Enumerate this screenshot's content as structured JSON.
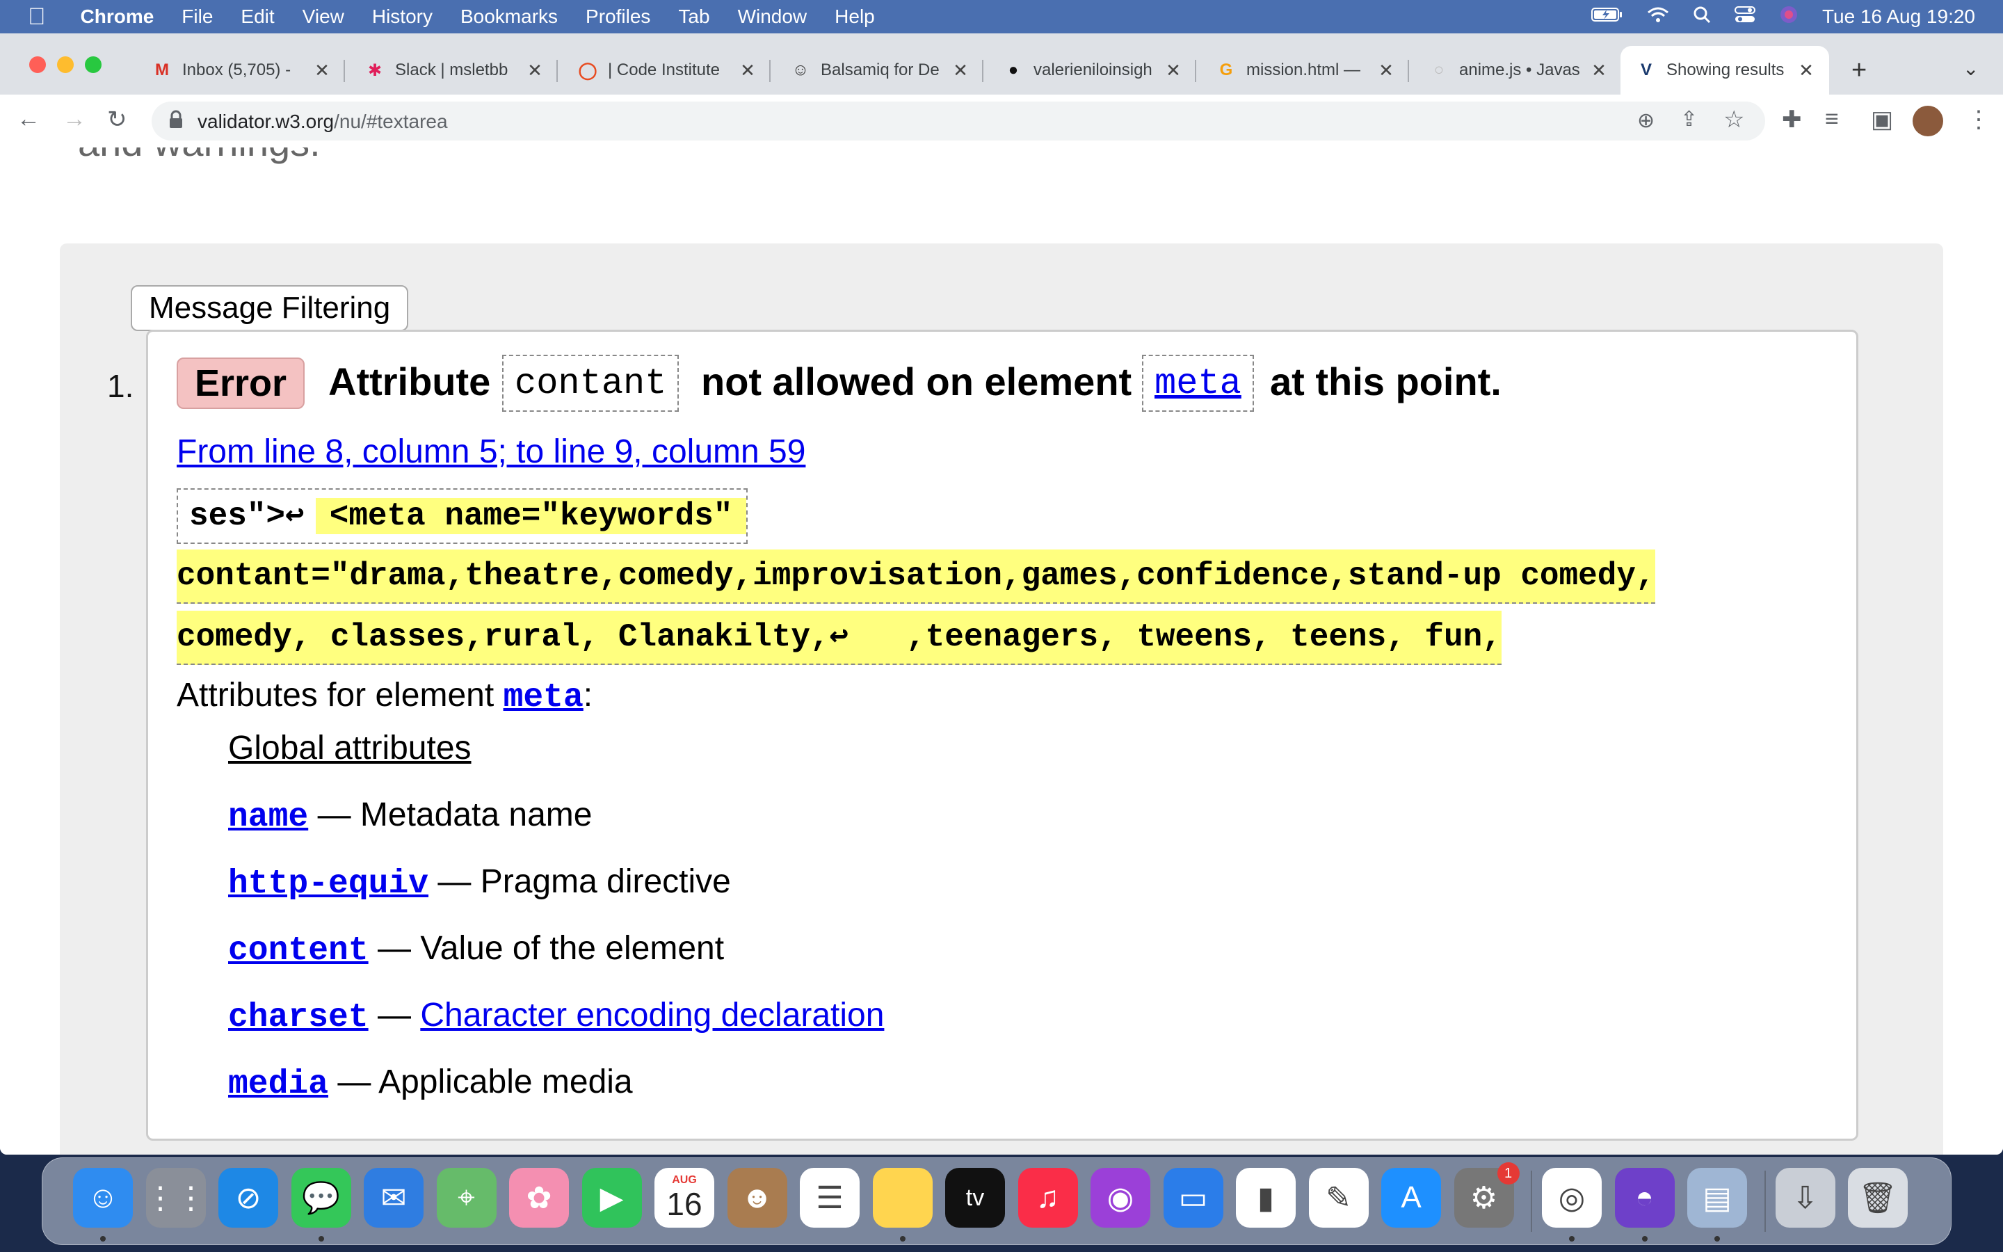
{
  "menubar": {
    "app": "Chrome",
    "items": [
      "File",
      "Edit",
      "View",
      "History",
      "Bookmarks",
      "Profiles",
      "Tab",
      "Window",
      "Help"
    ],
    "datetime": "Tue 16 Aug  19:20"
  },
  "tabs": [
    {
      "title": "Inbox (5,705) -",
      "icon": "gmail-icon",
      "color": "#d93025",
      "glyph": "M"
    },
    {
      "title": "Slack | msletbb",
      "icon": "slack-icon",
      "color": "#611f69",
      "glyph": "✱"
    },
    {
      "title": "| Code Institute",
      "icon": "code-institute-icon",
      "color": "#e84a1f",
      "glyph": "◯"
    },
    {
      "title": "Balsamiq for De",
      "icon": "balsamiq-icon",
      "color": "#333333",
      "glyph": "☺"
    },
    {
      "title": "valerieniloinsigh",
      "icon": "github-icon",
      "color": "#111111",
      "glyph": "●"
    },
    {
      "title": "mission.html —",
      "icon": "gitpod-icon",
      "color": "#f59e0b",
      "glyph": "G"
    },
    {
      "title": "anime.js • Javas",
      "icon": "animejs-icon",
      "color": "#cccccc",
      "glyph": "○"
    },
    {
      "title": "Showing results",
      "icon": "w3c-icon",
      "color": "#1a3a6e",
      "glyph": "V"
    }
  ],
  "toolbar": {
    "url_host": "validator.w3.org",
    "url_path": "/nu/#textarea"
  },
  "page": {
    "top_cut_text": "and warnings.",
    "filter_button": "Message Filtering",
    "message": {
      "number": "1.",
      "severity": "Error",
      "text_1": "Attribute",
      "code_1": "contant",
      "text_2": "not allowed on element",
      "code_2": "meta",
      "text_3": "at this point.",
      "location": "From line 8, column 5; to line 9, column 59",
      "extract_context": "ses\">↩",
      "extract_line_1": "<meta name=\"keywords\"",
      "extract_line_2": "contant=\"drama,theatre,comedy,improvisation,games,confidence,stand-up comedy,",
      "extract_line_3a": "comedy, classes,rural, Clanakilty,↩",
      "extract_line_3b": ",teenagers, tweens, teens, fun,"
    },
    "attributes": {
      "intro": "Attributes for element",
      "element": "meta",
      "colon": ":",
      "global": "Global attributes",
      "items": [
        {
          "name": "name",
          "desc": "— Metadata name"
        },
        {
          "name": "http-equiv",
          "desc": "— Pragma directive"
        },
        {
          "name": "content",
          "desc": "— Value of the element"
        },
        {
          "name": "charset",
          "desc": "— ",
          "desc_link": "Character encoding declaration"
        },
        {
          "name": "media",
          "desc": "— Applicable media"
        }
      ]
    }
  },
  "dock": {
    "calendar_month": "AUG",
    "calendar_day": "16",
    "settings_badge": "1",
    "apps": [
      {
        "name": "finder-icon",
        "color": "#2f8cf0"
      },
      {
        "name": "launchpad-icon",
        "color": "#8a8f99"
      },
      {
        "name": "safari-icon",
        "color": "#1e88e5"
      },
      {
        "name": "messages-icon",
        "color": "#34c759"
      },
      {
        "name": "mail-icon",
        "color": "#2f7de1"
      },
      {
        "name": "maps-icon",
        "color": "#66bb6a"
      },
      {
        "name": "photos-icon",
        "color": "#f48fb1"
      },
      {
        "name": "facetime-icon",
        "color": "#30c35b"
      },
      {
        "name": "calendar-icon",
        "color": "#ffffff"
      },
      {
        "name": "contacts-icon",
        "color": "#a97c50"
      },
      {
        "name": "reminders-icon",
        "color": "#ffffff"
      },
      {
        "name": "notes-icon",
        "color": "#ffd54f"
      },
      {
        "name": "appletv-icon",
        "color": "#111111"
      },
      {
        "name": "music-icon",
        "color": "#fa2d48"
      },
      {
        "name": "podcasts-icon",
        "color": "#9b40d8"
      },
      {
        "name": "keynote-icon",
        "color": "#2b7de9"
      },
      {
        "name": "numbers-icon",
        "color": "#ffffff"
      },
      {
        "name": "pages-icon",
        "color": "#ffffff"
      },
      {
        "name": "appstore-icon",
        "color": "#1e90ff"
      },
      {
        "name": "system-preferences-icon",
        "color": "#777777"
      },
      {
        "name": "chrome-icon",
        "color": "#ffffff"
      },
      {
        "name": "github-desktop-icon",
        "color": "#6e40c9"
      },
      {
        "name": "preview-icon",
        "color": "#9fb6d4"
      },
      {
        "name": "downloads-icon",
        "color": "#c9ced6"
      },
      {
        "name": "trash-icon",
        "color": "#d9dde3"
      }
    ]
  }
}
